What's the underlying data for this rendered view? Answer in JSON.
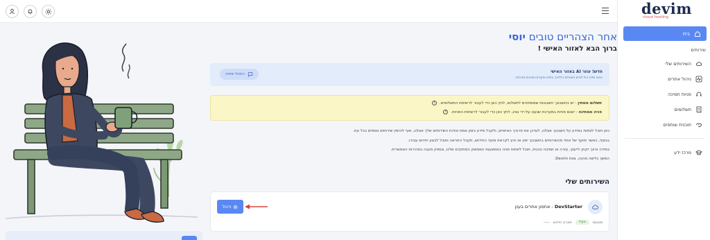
{
  "brand": {
    "name": "devim",
    "tagline": "cloud hosting"
  },
  "sidebar": {
    "home_label": "בית",
    "section_label": "שירותים",
    "items": [
      {
        "label": "השירותים שלי",
        "icon": "cloud-icon"
      },
      {
        "label": "ניהול אתרים",
        "icon": "activity-icon"
      },
      {
        "label": "פניות תמיכה",
        "icon": "headset-icon"
      },
      {
        "label": "תשלומים",
        "icon": "receipt-icon"
      },
      {
        "label": "תוכנית שותפים",
        "icon": "handshake-icon"
      }
    ],
    "knowledge_label": "מרכז ידע"
  },
  "main": {
    "greeting_prefix": "אחר הצהריים טובים",
    "user_name": "יוסי",
    "subtitle": "ברוך הבא לאזור האישי !",
    "ai_banner": {
      "title": "חדש! עוזר AI באזור האישי",
      "description": "הבוט שלנו יכול לסייע בשאלות כלליות, טיפים ופקודות מובנות מהירות.",
      "button_label": "התחל שיחה"
    },
    "alerts": [
      {
        "title": "תשלום ממתין",
        "text": " - יש בחשבונך חשבונות שממתינים לתשלום, לחץ כאן כדי לעבור לרשימת התשלומים."
      },
      {
        "title": "פניה ממתינה",
        "text": " - ישנם פניות במערכת שנענו על-ידי נציג, לחץ כאן כדי לעבור לרשימת הפניות."
      }
    ],
    "paragraphs": [
      "כאן תוכל לצפות במידע על חשבונך אצלנו, לעדכן את פרטיך האישיים, ולקבל מידע בזמן אמת אודות השירותים שלך אצלנו, ואף להזמין שירותים נוספים בכל עת.",
      "בנוסף, כאשר תוקף של אחד מהשירותים בחשבונך יפוג או יגיע לקראת מועד החידוש, תקבל התראה ותוכל לבצע חידוש עבורו.",
      "במידה והינך זקוק לייעוץ, עזרה או תמיכה טכנית, תוכל לפתוח פניה באמצעות הממשק המתקדם שלנו, ונספק מענה במהירות האפשרית.",
      "המשך גלישה מהנה, צוות Devim."
    ],
    "services_title": "השירותים שלי",
    "service": {
      "name_bold": "DevStarter",
      "name_rest": " - אחסון אתרים בענן",
      "manage_label": "ניהול",
      "status_label": "סטטוס",
      "status_value": "פעיל",
      "renewal_label": "תאריך חידוש",
      "renewal_value": "-----"
    }
  },
  "colors": {
    "primary": "#5a88f3",
    "heading": "#3a66d6",
    "alert_bg": "#fbf6c5",
    "ai_bg": "#e2ecfb",
    "arrow": "#d9443b"
  }
}
